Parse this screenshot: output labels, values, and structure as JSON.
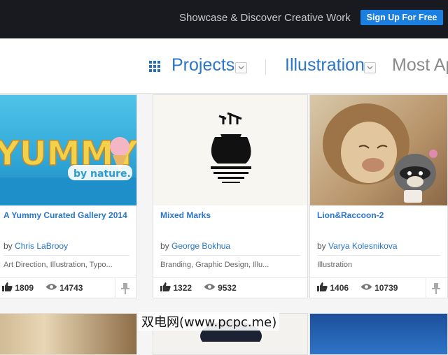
{
  "topbar": {
    "tagline": "Showcase & Discover Creative Work",
    "signup_label": "Sign Up For Free"
  },
  "filters": {
    "projects": "Projects",
    "illustration": "Illustration",
    "sort": "Most Ap"
  },
  "cards": [
    {
      "title": "A Yummy Curated Gallery 2014",
      "by": "by",
      "author": "Chris LaBrooy",
      "fields": "Art Direction, Illustration, Typo...",
      "likes": "1809",
      "views": "14743",
      "thumb_text": "by nature."
    },
    {
      "title": "Mixed Marks",
      "by": "by",
      "author": "George Bokhua",
      "fields": "Branding, Graphic Design, Illu...",
      "likes": "1322",
      "views": "9532"
    },
    {
      "title": "Lion&Raccoon-2",
      "by": "by",
      "author": "Varya Kolesnikova",
      "fields": "Illustration",
      "likes": "1406",
      "views": "10739"
    }
  ],
  "watermark": "双电网(www.pcpc.me)",
  "colors": {
    "accent": "#2a76c8",
    "signup": "#1a7fe0",
    "topbar": "#191a1f"
  }
}
